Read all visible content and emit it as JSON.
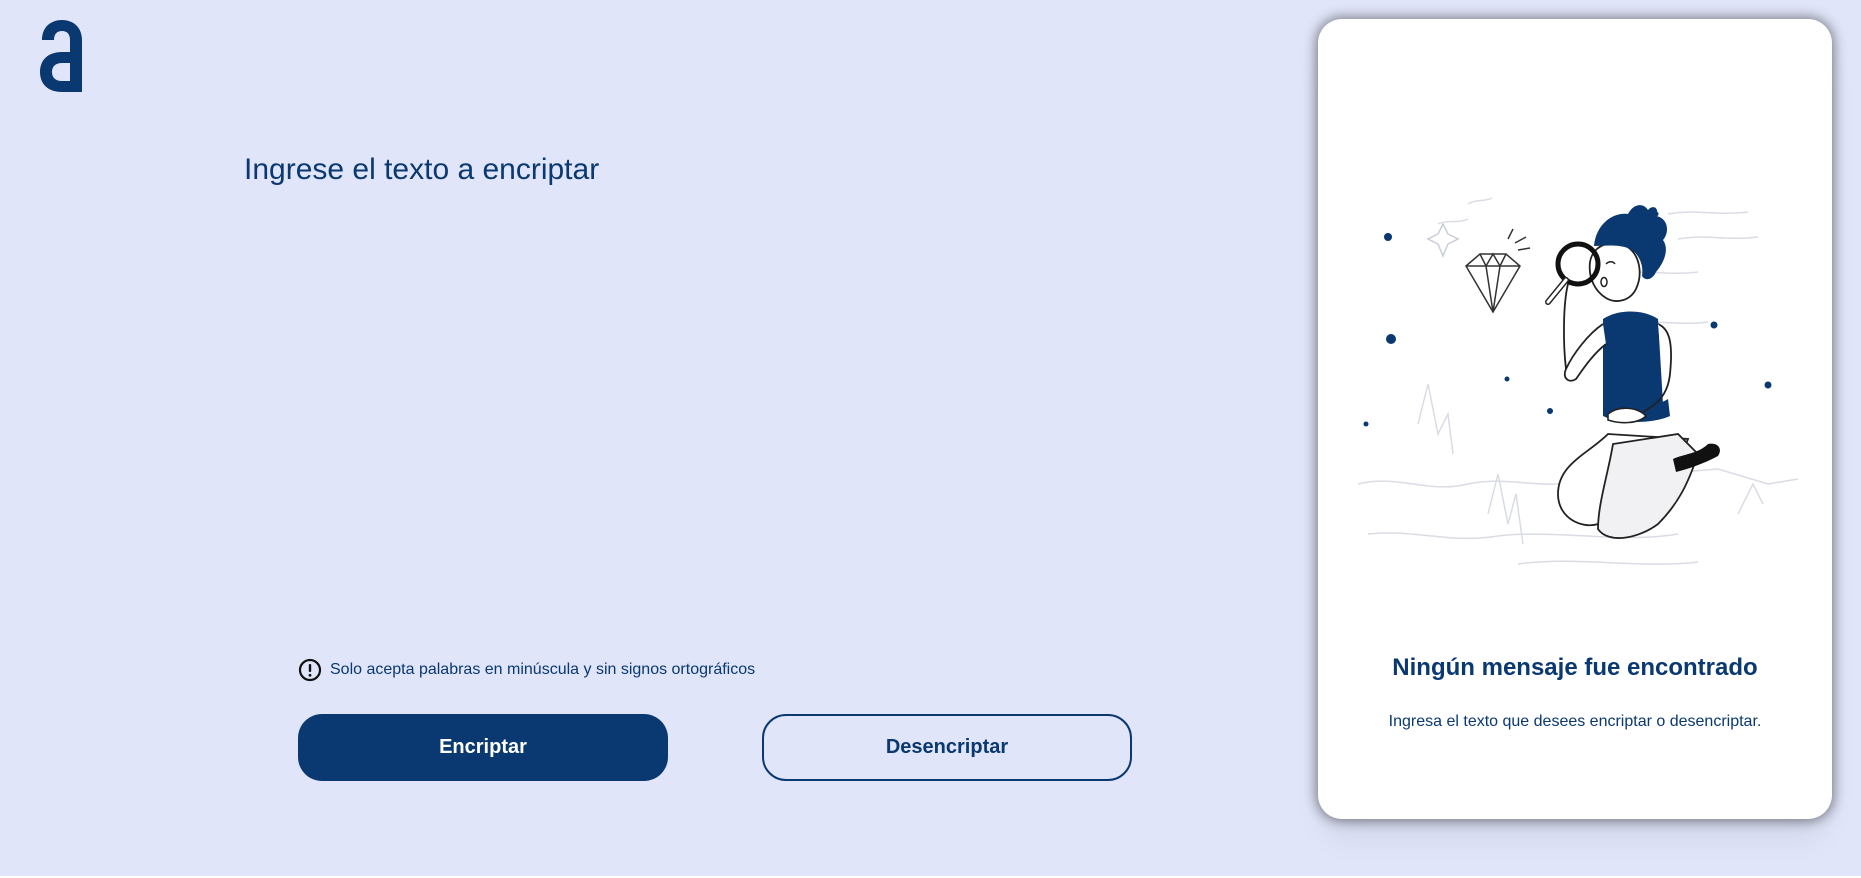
{
  "brand": {
    "logo_letter": "a",
    "primary_color": "#0A3871",
    "background_color": "#E0E5F9"
  },
  "input": {
    "placeholder": "Ingrese el texto a encriptar",
    "value": ""
  },
  "hint": {
    "icon": "exclamation-circle-icon",
    "text": "Solo acepta palabras en minúscula y sin signos ortográficos"
  },
  "actions": {
    "encrypt_label": "Encriptar",
    "decrypt_label": "Desencriptar"
  },
  "output_panel": {
    "illustration": "person-with-magnifier-looking-at-diamond",
    "title": "Ningún mensaje fue encontrado",
    "subtitle": "Ingresa el texto que desees encriptar o desencriptar."
  }
}
